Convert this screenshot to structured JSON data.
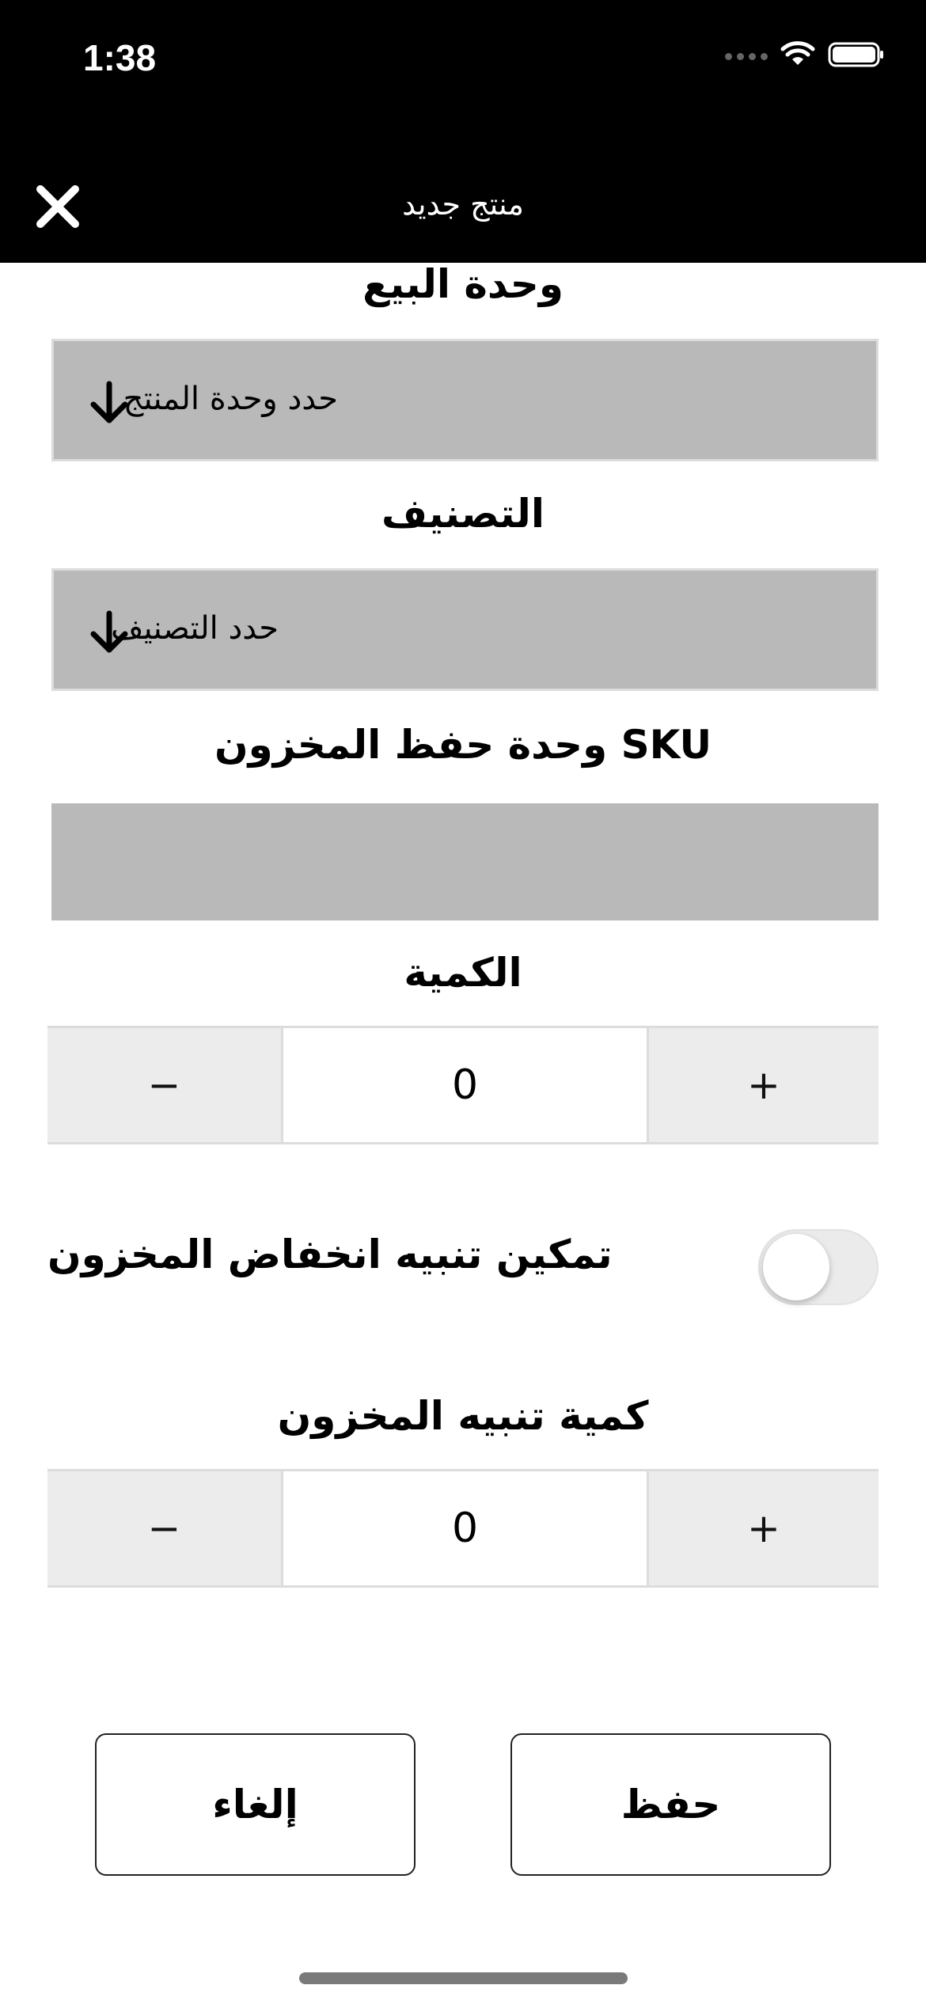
{
  "status_bar": {
    "time": "1:38"
  },
  "nav": {
    "title": "منتج جديد"
  },
  "fields": {
    "sale_unit": {
      "label": "وحدة البيع",
      "placeholder": "حدد وحدة المنتج"
    },
    "category": {
      "label": "التصنيف",
      "placeholder": "حدد التصنيف"
    },
    "sku": {
      "label": "وحدة حفظ المخزون SKU",
      "value": ""
    },
    "quantity": {
      "label": "الكمية",
      "value": "0",
      "minus": "−",
      "plus": "+"
    },
    "low_stock_alert": {
      "label": "تمكين تنبيه انخفاض المخزون",
      "enabled": false
    },
    "alert_quantity": {
      "label": "كمية تنبيه المخزون",
      "value": "0",
      "minus": "−",
      "plus": "+"
    }
  },
  "buttons": {
    "save": "حفظ",
    "cancel": "إلغاء"
  },
  "icons": {
    "close": "close-icon",
    "dropdown": "arrow-down-icon",
    "wifi": "wifi-icon",
    "battery": "battery-icon"
  }
}
